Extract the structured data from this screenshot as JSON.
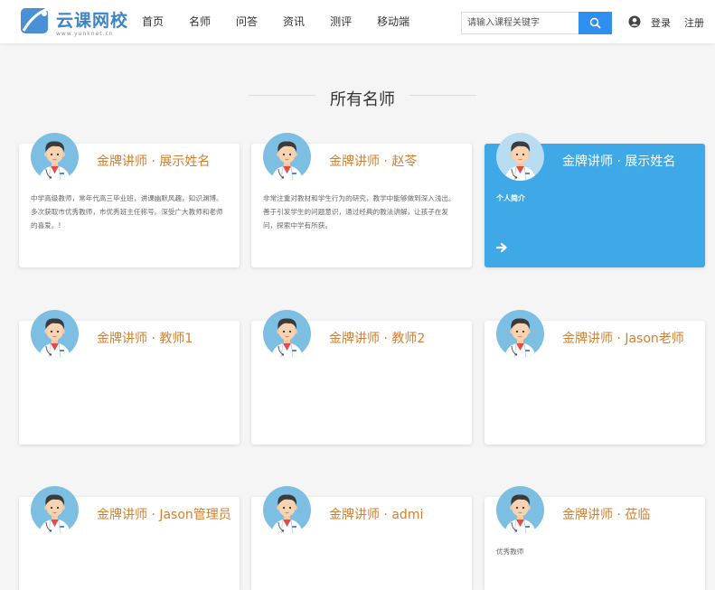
{
  "header": {
    "logo_text": "云课网校",
    "logo_sub": "www.yunknet.cn",
    "nav": [
      "首页",
      "名师",
      "问答",
      "资讯",
      "测评",
      "移动端"
    ],
    "search_placeholder": "请输入课程关键字",
    "login": "登录",
    "register": "注册"
  },
  "section_title": "所有名师",
  "teachers": [
    {
      "name": "金牌讲师 · 展示姓名",
      "desc": "中学高级教师，常年代高三毕业班，讲课幽默风趣，知识渊博。多次获取市优秀教师，市优秀班主任称号。深受广大教师和老师的喜爱。!"
    },
    {
      "name": "金牌讲师 · 赵苓",
      "desc": "非常注重对教材和学生行为的研究，教学中能够做到深入浅出。善于引发学生的问题意识，通过经典的教法讲解，让孩子在发问，探索中学有所获。"
    },
    {
      "name": "金牌讲师 · 展示姓名",
      "label": "个人简介",
      "desc": ""
    },
    {
      "name": "金牌讲师 · 教师1",
      "desc": ""
    },
    {
      "name": "金牌讲师 · 教师2",
      "desc": ""
    },
    {
      "name": "金牌讲师 · Jason老师",
      "desc": ""
    },
    {
      "name": "金牌讲师 · Jason管理员",
      "desc": ""
    },
    {
      "name": "金牌讲师 · admi",
      "desc": ""
    },
    {
      "name": "金牌讲师 · 莅临",
      "desc": "优秀教师"
    }
  ],
  "colors": {
    "accent": "#2f8ff0",
    "card_active": "#3ea9e6",
    "name_orange": "#d27f2c"
  },
  "icons": {
    "logo": "logo-mark-icon",
    "search": "search-icon",
    "user": "user-icon",
    "avatar": "doctor-avatar-icon",
    "arrow": "arrow-right-icon"
  }
}
